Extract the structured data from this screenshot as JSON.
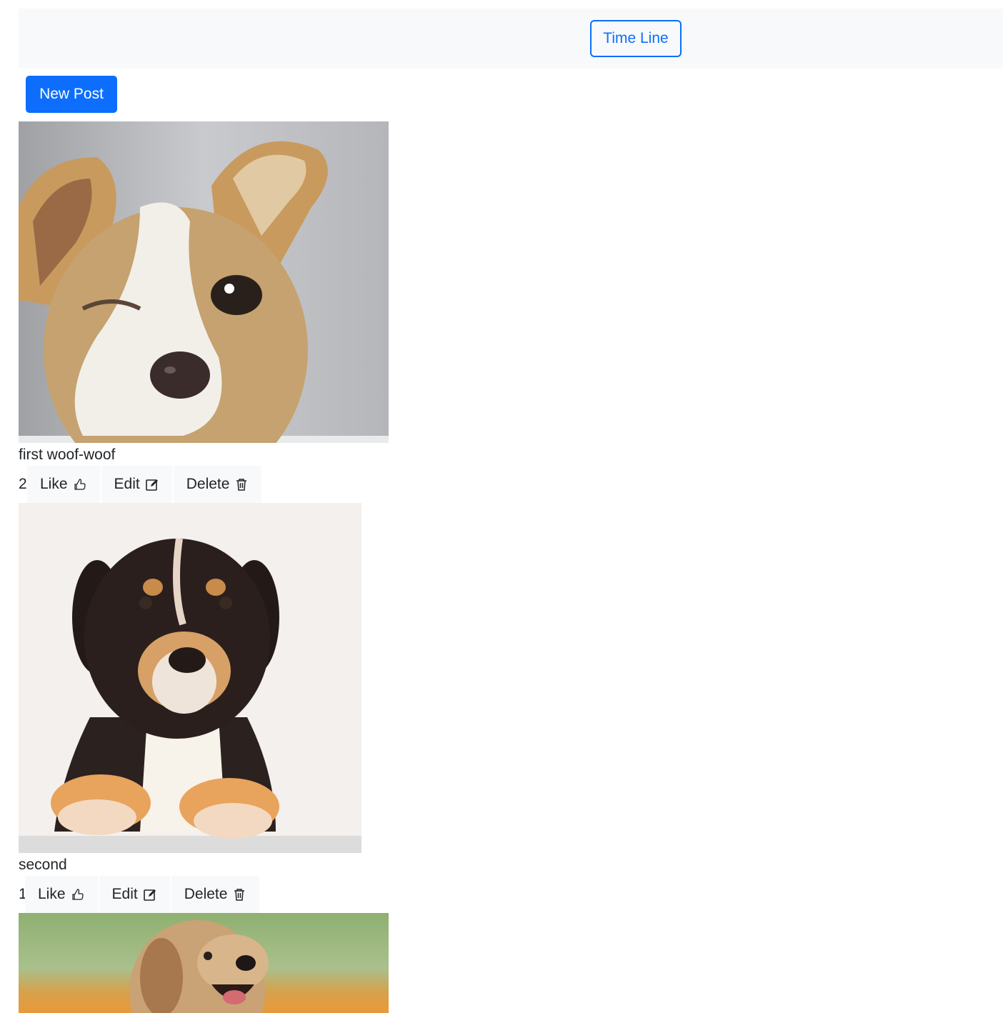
{
  "navbar": {
    "timeline_label": "Time Line"
  },
  "toolbar": {
    "new_post_label": "New Post"
  },
  "posts": [
    {
      "caption": "first woof-woof",
      "likes": "2",
      "image_desc": "dog winking"
    },
    {
      "caption": "second",
      "likes": "1",
      "image_desc": "puppy lying"
    },
    {
      "caption": "",
      "likes": "",
      "image_desc": "golden puppy"
    }
  ],
  "actions": {
    "like_label": "Like",
    "edit_label": "Edit",
    "delete_label": "Delete"
  },
  "colors": {
    "primary": "#0d6efd",
    "navbar_bg": "#f8f9fa",
    "action_bg": "#f8f9fa"
  },
  "icons": {
    "like": "thumbs-up-icon",
    "edit": "pencil-square-icon",
    "delete": "trash-icon"
  }
}
